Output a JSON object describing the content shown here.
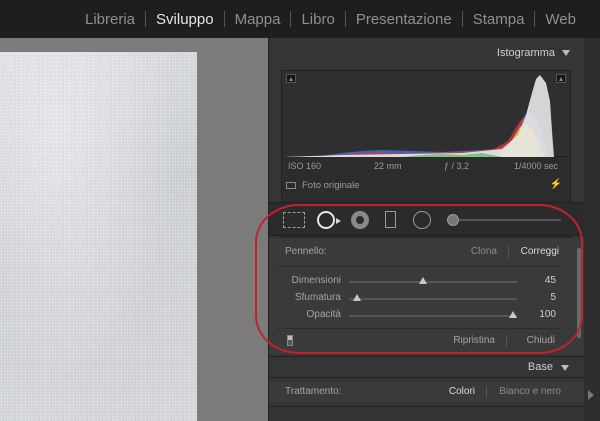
{
  "modules": [
    {
      "label": "Libreria",
      "active": false
    },
    {
      "label": "Sviluppo",
      "active": true
    },
    {
      "label": "Mappa",
      "active": false
    },
    {
      "label": "Libro",
      "active": false
    },
    {
      "label": "Presentazione",
      "active": false
    },
    {
      "label": "Stampa",
      "active": false
    },
    {
      "label": "Web",
      "active": false
    }
  ],
  "histogram": {
    "title": "Istogramma",
    "iso": "ISO 160",
    "focal": "22 mm",
    "aperture": "ƒ / 3,2",
    "shutter": "1/4000 sec",
    "original_label": "Foto originale"
  },
  "brush": {
    "label": "Pennello:",
    "mode_clone": "Clona",
    "mode_heal": "Correggi",
    "active_mode": "Correggi",
    "sliders": [
      {
        "label": "Dimensioni",
        "value": "45",
        "level": 0.45
      },
      {
        "label": "Sfumatura",
        "value": "5",
        "level": 0.05
      },
      {
        "label": "Opacità",
        "value": "100",
        "level": 1.0
      }
    ],
    "reset": "Ripristina",
    "close": "Chiudi"
  },
  "base": {
    "title": "Base",
    "treatment_label": "Trattamento:",
    "color": "Colori",
    "bw": "Bianco e nero"
  },
  "colors": {
    "highlight_ring": "#c2222b",
    "panel_bg": "#353535",
    "topbar_bg": "#1e1e1e"
  }
}
